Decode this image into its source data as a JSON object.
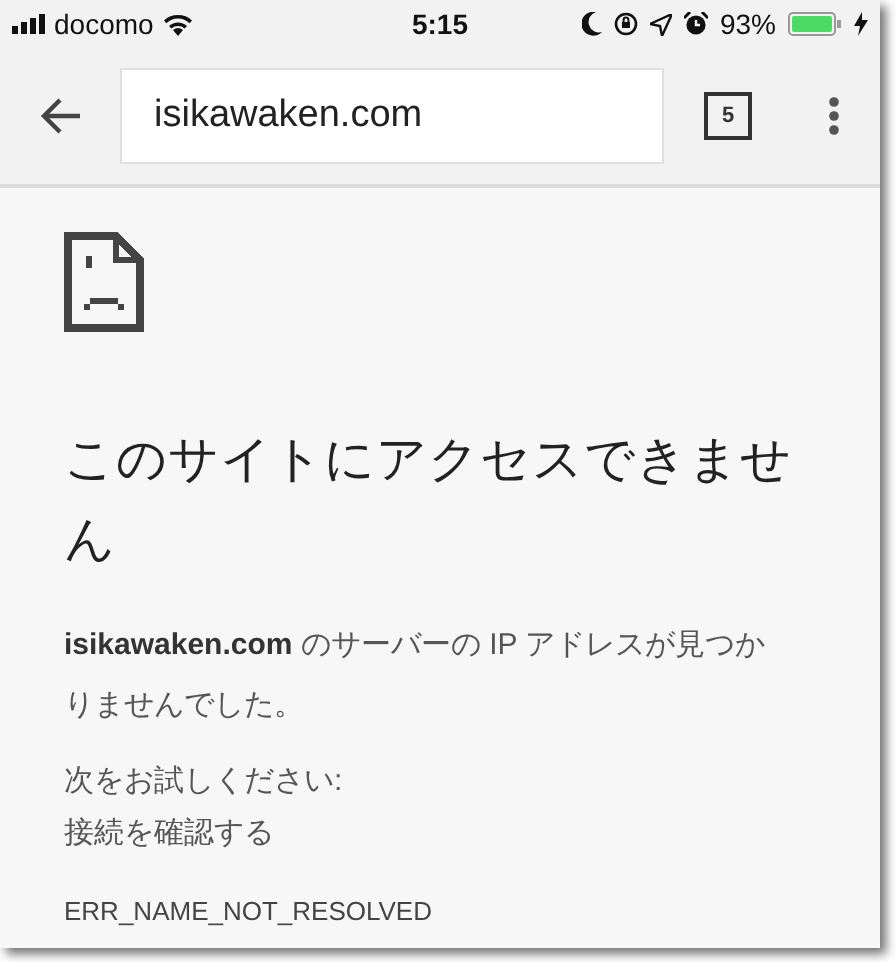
{
  "status_bar": {
    "carrier": "docomo",
    "time": "5:15",
    "battery": "93%"
  },
  "toolbar": {
    "url": "isikawaken.com",
    "tab_count": "5"
  },
  "error": {
    "title": "このサイトにアクセスできません",
    "description": "**isikawaken.com** のサーバーの IP アドレスが見つかりませんでした。",
    "suggestions_heading": "次をお試しください:",
    "suggestions": [
      "接続を確認する"
    ],
    "code": "ERR_NAME_NOT_RESOLVED"
  }
}
